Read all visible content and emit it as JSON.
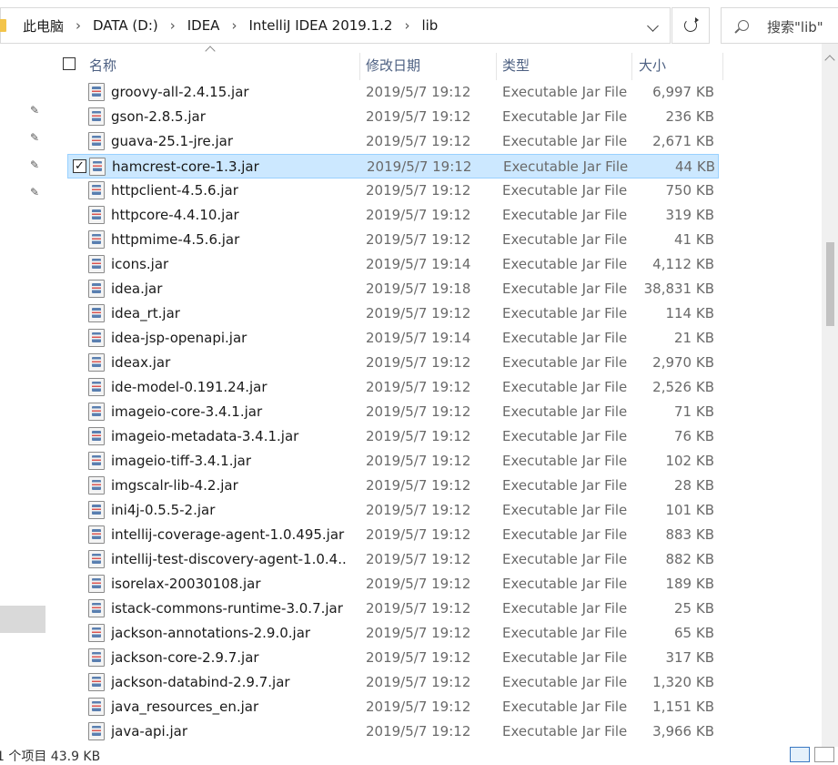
{
  "address_bar": {
    "crumbs": [
      "此电脑",
      "DATA (D:)",
      "IDEA",
      "IntelliJ IDEA 2019.1.2",
      "lib"
    ]
  },
  "search": {
    "placeholder": "搜索\"lib\""
  },
  "columns": {
    "name": "名称",
    "date": "修改日期",
    "type": "类型",
    "size": "大小"
  },
  "files": [
    {
      "name": "groovy-all-2.4.15.jar",
      "date": "2019/5/7 19:12",
      "type": "Executable Jar File",
      "size": "6,997 KB"
    },
    {
      "name": "gson-2.8.5.jar",
      "date": "2019/5/7 19:12",
      "type": "Executable Jar File",
      "size": "236 KB"
    },
    {
      "name": "guava-25.1-jre.jar",
      "date": "2019/5/7 19:12",
      "type": "Executable Jar File",
      "size": "2,671 KB"
    },
    {
      "name": "hamcrest-core-1.3.jar",
      "date": "2019/5/7 19:12",
      "type": "Executable Jar File",
      "size": "44 KB",
      "selected": true
    },
    {
      "name": "httpclient-4.5.6.jar",
      "date": "2019/5/7 19:12",
      "type": "Executable Jar File",
      "size": "750 KB"
    },
    {
      "name": "httpcore-4.4.10.jar",
      "date": "2019/5/7 19:12",
      "type": "Executable Jar File",
      "size": "319 KB"
    },
    {
      "name": "httpmime-4.5.6.jar",
      "date": "2019/5/7 19:12",
      "type": "Executable Jar File",
      "size": "41 KB"
    },
    {
      "name": "icons.jar",
      "date": "2019/5/7 19:14",
      "type": "Executable Jar File",
      "size": "4,112 KB"
    },
    {
      "name": "idea.jar",
      "date": "2019/5/7 19:18",
      "type": "Executable Jar File",
      "size": "38,831 KB"
    },
    {
      "name": "idea_rt.jar",
      "date": "2019/5/7 19:12",
      "type": "Executable Jar File",
      "size": "114 KB"
    },
    {
      "name": "idea-jsp-openapi.jar",
      "date": "2019/5/7 19:14",
      "type": "Executable Jar File",
      "size": "21 KB"
    },
    {
      "name": "ideax.jar",
      "date": "2019/5/7 19:12",
      "type": "Executable Jar File",
      "size": "2,970 KB"
    },
    {
      "name": "ide-model-0.191.24.jar",
      "date": "2019/5/7 19:12",
      "type": "Executable Jar File",
      "size": "2,526 KB"
    },
    {
      "name": "imageio-core-3.4.1.jar",
      "date": "2019/5/7 19:12",
      "type": "Executable Jar File",
      "size": "71 KB"
    },
    {
      "name": "imageio-metadata-3.4.1.jar",
      "date": "2019/5/7 19:12",
      "type": "Executable Jar File",
      "size": "76 KB"
    },
    {
      "name": "imageio-tiff-3.4.1.jar",
      "date": "2019/5/7 19:12",
      "type": "Executable Jar File",
      "size": "102 KB"
    },
    {
      "name": "imgscalr-lib-4.2.jar",
      "date": "2019/5/7 19:12",
      "type": "Executable Jar File",
      "size": "28 KB"
    },
    {
      "name": "ini4j-0.5.5-2.jar",
      "date": "2019/5/7 19:12",
      "type": "Executable Jar File",
      "size": "101 KB"
    },
    {
      "name": "intellij-coverage-agent-1.0.495.jar",
      "date": "2019/5/7 19:12",
      "type": "Executable Jar File",
      "size": "883 KB"
    },
    {
      "name": "intellij-test-discovery-agent-1.0.4...",
      "date": "2019/5/7 19:12",
      "type": "Executable Jar File",
      "size": "882 KB"
    },
    {
      "name": "isorelax-20030108.jar",
      "date": "2019/5/7 19:12",
      "type": "Executable Jar File",
      "size": "189 KB"
    },
    {
      "name": "istack-commons-runtime-3.0.7.jar",
      "date": "2019/5/7 19:12",
      "type": "Executable Jar File",
      "size": "25 KB"
    },
    {
      "name": "jackson-annotations-2.9.0.jar",
      "date": "2019/5/7 19:12",
      "type": "Executable Jar File",
      "size": "65 KB"
    },
    {
      "name": "jackson-core-2.9.7.jar",
      "date": "2019/5/7 19:12",
      "type": "Executable Jar File",
      "size": "317 KB"
    },
    {
      "name": "jackson-databind-2.9.7.jar",
      "date": "2019/5/7 19:12",
      "type": "Executable Jar File",
      "size": "1,320 KB"
    },
    {
      "name": "java_resources_en.jar",
      "date": "2019/5/7 19:12",
      "type": "Executable Jar File",
      "size": "1,151 KB"
    },
    {
      "name": "java-api.jar",
      "date": "2019/5/7 19:12",
      "type": "Executable Jar File",
      "size": "3,966 KB"
    }
  ],
  "status_bar": {
    "text": "1 个项目  43.9 KB"
  },
  "icons": {
    "file": "jar-file-icon",
    "pin": "pin-icon",
    "refresh": "refresh-icon",
    "search": "search-icon",
    "dropdown": "chevron-down-icon",
    "folder": "folder-icon"
  },
  "colors": {
    "selection_bg": "#cce8ff",
    "selection_border": "#99d1ff",
    "header_text": "#4d6082"
  }
}
